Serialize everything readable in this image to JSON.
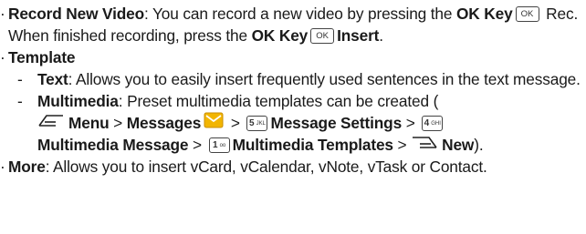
{
  "items": {
    "record": {
      "bullet": "·",
      "title": "Record New Video",
      "text1": ": You can record a new video by pressing the ",
      "ok_key_label": "OK Key",
      "ok_icon": "OK",
      "text2": " Rec. When finished recording, press the ",
      "ok_key_label2": "OK Key",
      "ok_icon2": "OK",
      "insert_label": "Insert",
      "end": "."
    },
    "template": {
      "bullet": "·",
      "title": "Template",
      "text_item": {
        "dash": "-",
        "title": "Text",
        "desc": ": Allows you to easily insert frequently used sentences in the text message."
      },
      "multimedia_item": {
        "dash": "-",
        "title": "Multimedia",
        "desc": ": Preset multimedia templates can be created (",
        "menu_label": "Menu",
        "sep1": " > ",
        "messages_label": "Messages",
        "sep2": " > ",
        "key5": "5",
        "key5_sub": "JKL",
        "settings_label": "Message Settings",
        "sep3": " > ",
        "key4": "4",
        "key4_sub": "GHI",
        "mm_message_label": "Multimedia Message",
        "sep4": " > ",
        "key1": "1",
        "key1_sub": "oo",
        "mm_templates_label": "Multimedia Templates",
        "sep5": " > ",
        "new_label": "New",
        "end": ")."
      }
    },
    "more": {
      "bullet": "·",
      "title": "More",
      "desc": ": Allows you to insert vCard, vCalendar, vNote, vTask or Contact."
    }
  },
  "colors": {
    "text": "#1a1a1a",
    "messages_icon": "#f2b500"
  },
  "icons": {
    "left_softkey": "left-softkey-icon",
    "right_softkey": "right-softkey-icon",
    "messages": "envelope-icon"
  }
}
